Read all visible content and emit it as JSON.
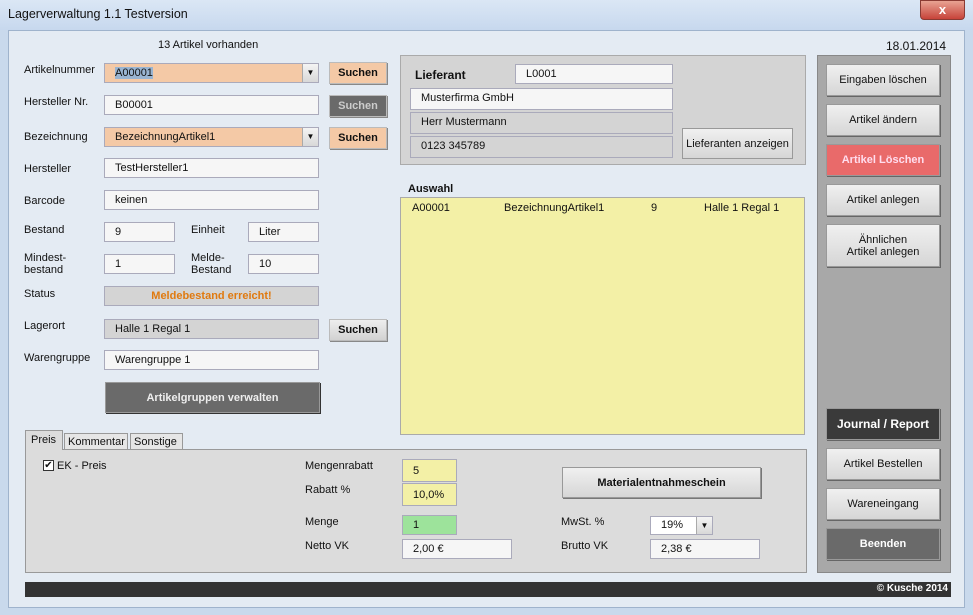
{
  "window": {
    "title": "Lagerverwaltung 1.1 Testversion",
    "close_label": "x"
  },
  "header": {
    "count": "13 Artikel vorhanden",
    "date": "18.01.2014"
  },
  "form": {
    "artikelnummer": {
      "label": "Artikelnummer",
      "value": "A00001"
    },
    "herstellernr": {
      "label": "Hersteller Nr.",
      "value": "B00001"
    },
    "bezeichnung": {
      "label": "Bezeichnung",
      "value": "BezeichnungArtikel1"
    },
    "hersteller": {
      "label": "Hersteller",
      "value": "TestHersteller1"
    },
    "barcode": {
      "label": "Barcode",
      "value": "keinen"
    },
    "bestand": {
      "label": "Bestand",
      "value": "9"
    },
    "einheit": {
      "label": "Einheit",
      "value": "Liter"
    },
    "mindestbestand": {
      "label": "Mindest-\nbestand",
      "value": "1"
    },
    "meldebestand": {
      "label": "Melde-\nBestand",
      "value": "10"
    },
    "status": {
      "label": "Status",
      "value": "Meldebestand erreicht!"
    },
    "lagerort": {
      "label": "Lagerort",
      "value": "Halle 1 Regal 1"
    },
    "warengruppe": {
      "label": "Warengruppe",
      "value": "Warengruppe 1"
    },
    "search_label": "Suchen",
    "artikelgruppen_button": "Artikelgruppen verwalten"
  },
  "lieferant": {
    "label": "Lieferant",
    "id": "L0001",
    "firma": "Musterfirma GmbH",
    "kontakt": "Herr Mustermann",
    "telefon": "0123 345789",
    "show_button": "Lieferanten anzeigen"
  },
  "auswahl": {
    "label": "Auswahl",
    "rows": [
      {
        "nr": "A00001",
        "bez": "BezeichnungArtikel1",
        "bestand": "9",
        "ort": "Halle 1 Regal 1"
      }
    ]
  },
  "actions": {
    "eingaben_loeschen": "Eingaben löschen",
    "artikel_aendern": "Artikel ändern",
    "artikel_loeschen": "Artikel Löschen",
    "artikel_anlegen": "Artikel anlegen",
    "aehnlichen_anlegen": "Ähnlichen\nArtikel anlegen",
    "journal": "Journal / Report",
    "bestellen": "Artikel Bestellen",
    "wareneingang": "Wareneingang",
    "beenden": "Beenden"
  },
  "tabs": [
    {
      "label": "Preis"
    },
    {
      "label": "Kommentar"
    },
    {
      "label": "Sonstige"
    }
  ],
  "preis": {
    "ek_label": "EK - Preis",
    "ek_checked": true,
    "mengenrabatt_label": "Mengenrabatt",
    "mengenrabatt": "5",
    "rabatt_label": "Rabatt %",
    "rabatt": "10,0%",
    "menge_label": "Menge",
    "menge": "1",
    "netto_label": "Netto VK",
    "netto": "2,00 €",
    "mwst_label": "MwSt. %",
    "mwst": "19%",
    "brutto_label": "Brutto VK",
    "brutto": "2,38 €",
    "materialentnahme": "Materialentnahmeschein"
  },
  "footer": {
    "copyright": "© Kusche 2014"
  }
}
